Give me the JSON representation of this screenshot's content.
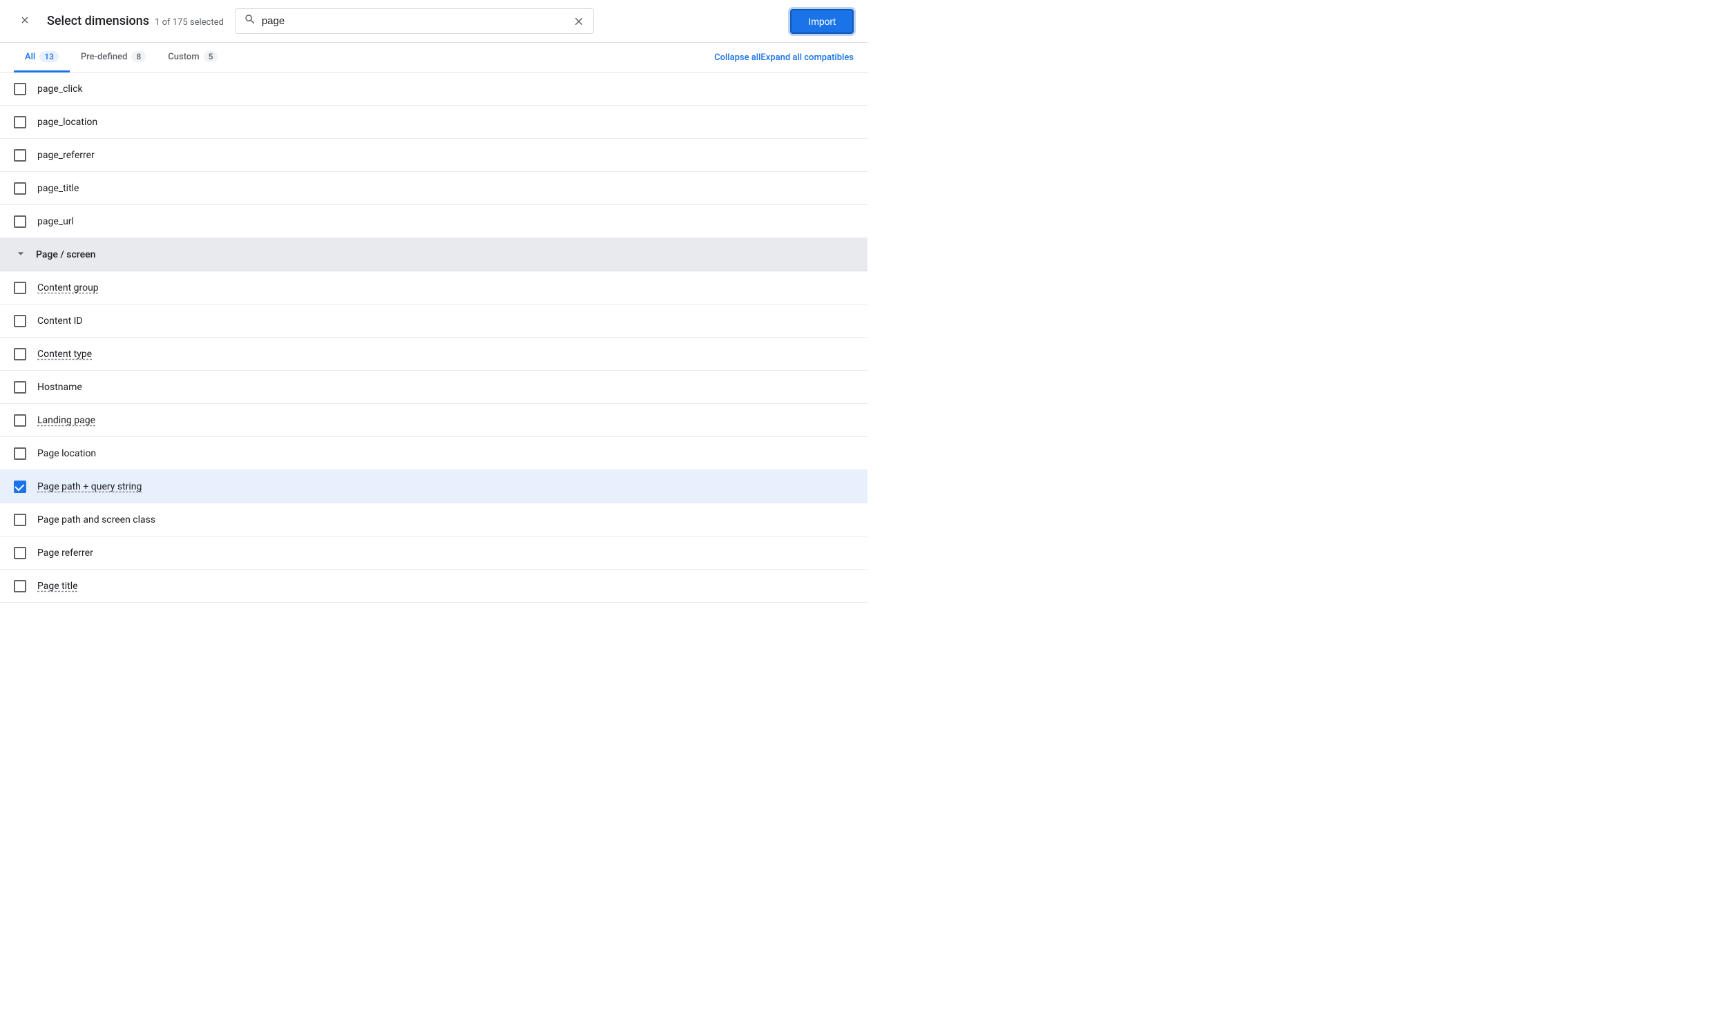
{
  "header": {
    "close_label": "×",
    "title": "Select dimensions",
    "subtitle": "1 of 175 selected",
    "search_placeholder": "page",
    "search_value": "page",
    "import_label": "Import"
  },
  "tabs": [
    {
      "id": "all",
      "label": "All",
      "count": "13",
      "active": true
    },
    {
      "id": "predefined",
      "label": "Pre-defined",
      "count": "8",
      "active": false
    },
    {
      "id": "custom",
      "label": "Custom",
      "count": "5",
      "active": false
    }
  ],
  "actions": {
    "collapse_all": "Collapse all",
    "expand_all": "Expand all compatibles"
  },
  "items_above_group": [
    {
      "id": "page_click",
      "label": "page_click",
      "checked": false,
      "underline": false
    },
    {
      "id": "page_location",
      "label": "page_location",
      "checked": false,
      "underline": false
    },
    {
      "id": "page_referrer",
      "label": "page_referrer",
      "checked": false,
      "underline": false
    },
    {
      "id": "page_title",
      "label": "page_title",
      "checked": false,
      "underline": false
    },
    {
      "id": "page_url",
      "label": "page_url",
      "checked": false,
      "underline": false
    }
  ],
  "group": {
    "label": "Page / screen",
    "expanded": true
  },
  "group_items": [
    {
      "id": "content_group",
      "label": "Content group",
      "checked": false,
      "underline": true
    },
    {
      "id": "content_id",
      "label": "Content ID",
      "checked": false,
      "underline": false
    },
    {
      "id": "content_type",
      "label": "Content type",
      "checked": false,
      "underline": true
    },
    {
      "id": "hostname",
      "label": "Hostname",
      "checked": false,
      "underline": false
    },
    {
      "id": "landing_page",
      "label": "Landing page",
      "checked": false,
      "underline": true
    },
    {
      "id": "page_location",
      "label": "Page location",
      "checked": false,
      "underline": false
    },
    {
      "id": "page_path_query",
      "label": "Page path + query string",
      "checked": true,
      "underline": true
    },
    {
      "id": "page_path_screen",
      "label": "Page path and screen class",
      "checked": false,
      "underline": false
    },
    {
      "id": "page_referrer",
      "label": "Page referrer",
      "checked": false,
      "underline": false
    },
    {
      "id": "page_title",
      "label": "Page title",
      "checked": false,
      "underline": true
    }
  ]
}
